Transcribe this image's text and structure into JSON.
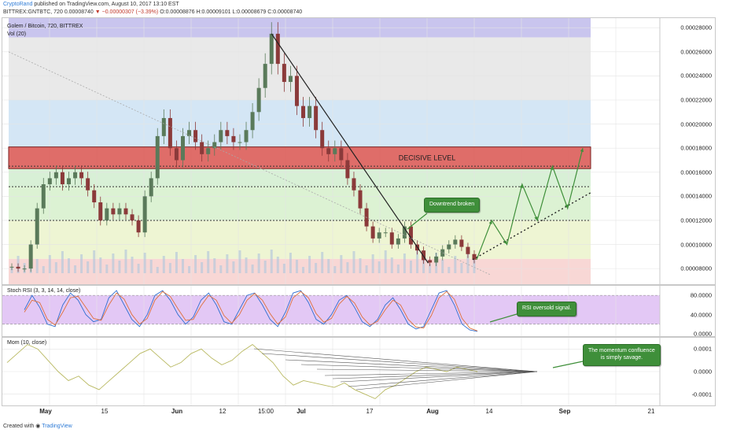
{
  "header": {
    "user": "CryptoRand",
    "published": "published on TradingView.com, August 10, 2017 13:10 EST",
    "symbol_line": "BITTREX:GNTBTC, 720",
    "last": "0.00008740",
    "change": "▼ −0.00000307 (−3.39%)",
    "ohlc": "O:0.00008876 H:0.00009101 L:0.00008679 C:0.00008740"
  },
  "panes": {
    "price_title": "Golem / Bitcoin, 720, BITTREX",
    "vol_label": "Vol (20)",
    "rsi_label": "Stoch RSI (3, 3, 14, 14, close)",
    "mom_label": "Mom (10, close)"
  },
  "annotations": {
    "decisive": "DECISIVE LEVEL",
    "downtrend": "Downtrend broken",
    "rsi": "RSI oversold signal.",
    "momentum_1": "The momentum confluence",
    "momentum_2": "is simply savage."
  },
  "footer": {
    "created": "Created with",
    "brand": "TradingView"
  },
  "colors": {
    "decisive_zone": "#d9534f",
    "callout": "#3f8f3a",
    "candle_up": "#5a7a5a",
    "candle_down": "#8b3a3a",
    "rsi_band": "#e3c8f5",
    "mom_line": "#b8b860"
  },
  "chart_data": [
    {
      "type": "candlestick",
      "title": "Golem / Bitcoin, 720, BITTREX",
      "y_ticks": [
        "0.00028000",
        "0.00026000",
        "0.00024000",
        "0.00022000",
        "0.00020000",
        "0.00018000",
        "0.00016000",
        "0.00014000",
        "0.00012000",
        "0.00010000",
        "0.00008000"
      ],
      "ylim": [
        6.7e-05,
        0.000288
      ],
      "x_labels": [
        "May",
        "15",
        "Jun",
        "12",
        "15:00",
        "Jul",
        "17",
        "Aug",
        "14",
        "Sep",
        "21"
      ],
      "closes": [
        8.15e-05,
        8e-05,
        8e-05,
        0.0001,
        0.00013,
        0.00015,
        0.000155,
        0.00016,
        0.00015,
        0.000155,
        0.00016,
        0.000155,
        0.000145,
        0.000135,
        0.00012,
        0.00013,
        0.000125,
        0.00013,
        0.000125,
        0.00012,
        0.00011,
        0.00014,
        0.000155,
        0.00019,
        0.000205,
        0.00018,
        0.00017,
        0.00019,
        0.000195,
        0.000185,
        0.000175,
        0.00018,
        0.000185,
        0.000195,
        0.00019,
        0.000185,
        0.000185,
        0.000195,
        0.00021,
        0.00023,
        0.00025,
        0.000275,
        0.00025,
        0.000235,
        0.00024,
        0.000215,
        0.000205,
        0.000215,
        0.000195,
        0.00018,
        0.000175,
        0.00018,
        0.00017,
        0.000155,
        0.000145,
        0.00013,
        0.000115,
        0.000105,
        0.00011,
        0.00011,
        0.0001,
        0.000105,
        0.000115,
        0.0001,
        9.5e-05,
        8.7e-05,
        8.5e-05,
        9e-05,
        9.6e-05,
        0.0001,
        0.000104,
        9.8e-05,
        9.2e-05,
        8.74e-05
      ],
      "overlays": {
        "decisive_level": [
          0.000163,
          0.000181
        ],
        "dotted_levels": [
          0.000165,
          0.000148,
          0.00012
        ],
        "projection": [
          8.74e-05,
          0.00012,
          0.0001,
          0.00015,
          0.00012,
          0.000165,
          0.00013,
          0.00018
        ]
      }
    },
    {
      "type": "line",
      "title": "Stoch RSI (3, 3, 14, 14, close)",
      "y_ticks": [
        "80.0000",
        "40.0000",
        "0.0000"
      ],
      "ylim": [
        -5,
        100
      ],
      "band": [
        20,
        80
      ],
      "series": [
        {
          "values": [
            50,
            80,
            55,
            20,
            15,
            60,
            85,
            70,
            40,
            25,
            30,
            75,
            90,
            60,
            30,
            15,
            40,
            80,
            90,
            70,
            40,
            20,
            35,
            70,
            85,
            60,
            25,
            20,
            50,
            80,
            85,
            60,
            30,
            15,
            45,
            85,
            90,
            65,
            30,
            20,
            40,
            70,
            80,
            55,
            25,
            15,
            30,
            60,
            75,
            50,
            20,
            10,
            15,
            50,
            85,
            90,
            60,
            20,
            8,
            5
          ]
        },
        {
          "values": [
            45,
            70,
            65,
            30,
            18,
            45,
            75,
            78,
            55,
            32,
            28,
            60,
            85,
            72,
            40,
            20,
            32,
            70,
            88,
            78,
            52,
            28,
            30,
            58,
            80,
            70,
            38,
            22,
            40,
            70,
            84,
            70,
            42,
            20,
            35,
            75,
            88,
            75,
            42,
            24,
            32,
            62,
            78,
            64,
            35,
            18,
            26,
            50,
            70,
            60,
            30,
            14,
            12,
            38,
            75,
            88,
            72,
            32,
            12,
            6
          ]
        }
      ]
    },
    {
      "type": "line",
      "title": "Mom (10, close)",
      "y_ticks": [
        "0.0001",
        "0.0000",
        "-0.0001"
      ],
      "ylim": [
        -0.00015,
        0.00015
      ],
      "series": [
        {
          "values": [
            4e-05,
            8e-05,
            0.00012,
            0.0001,
            5e-05,
            0.0,
            -4e-05,
            -2e-05,
            -6e-05,
            -8e-05,
            -4e-05,
            0.0,
            4e-05,
            8e-05,
            0.0001,
            6e-05,
            2e-05,
            4e-05,
            8e-05,
            0.0001,
            6e-05,
            3e-05,
            5e-05,
            9e-05,
            0.00012,
            8e-05,
            4e-05,
            -2e-05,
            -6e-05,
            -4e-05,
            -5e-05,
            -6e-05,
            -7e-05,
            -5e-05,
            -8e-05,
            -0.0001,
            -0.00012,
            -8e-05,
            -6e-05,
            -3e-05,
            0.0,
            2e-05,
            1e-05,
            0.0,
            2e-05,
            1e-05,
            0.0
          ]
        }
      ]
    }
  ]
}
